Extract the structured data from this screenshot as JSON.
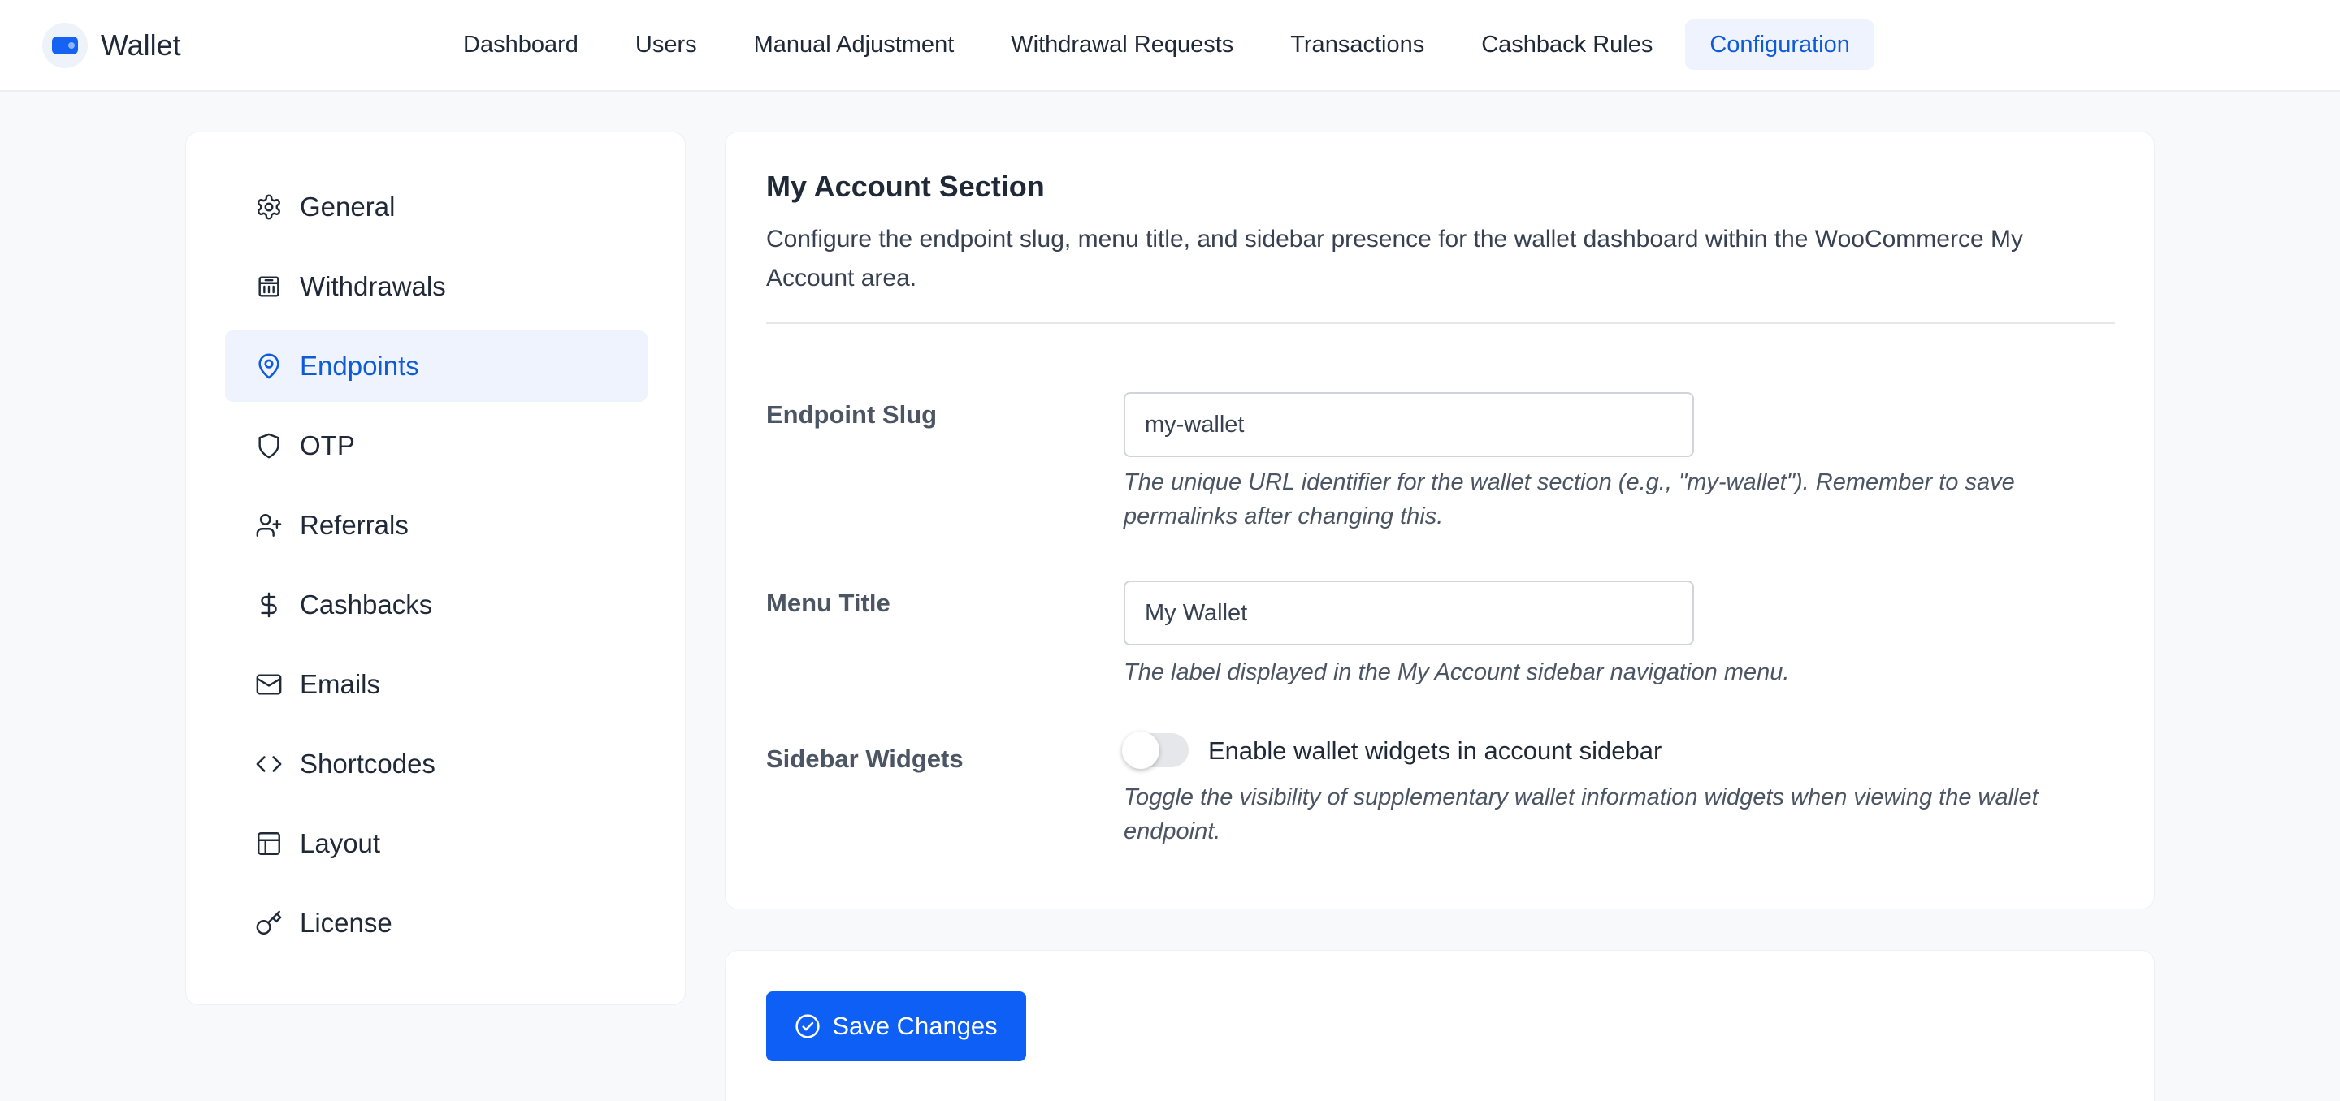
{
  "app": {
    "name": "Wallet"
  },
  "nav": {
    "items": [
      {
        "label": "Dashboard",
        "name": "nav-dashboard",
        "active": false
      },
      {
        "label": "Users",
        "name": "nav-users",
        "active": false
      },
      {
        "label": "Manual Adjustment",
        "name": "nav-manual-adjustment",
        "active": false
      },
      {
        "label": "Withdrawal Requests",
        "name": "nav-withdrawal-requests",
        "active": false
      },
      {
        "label": "Transactions",
        "name": "nav-transactions",
        "active": false
      },
      {
        "label": "Cashback Rules",
        "name": "nav-cashback-rules",
        "active": false
      },
      {
        "label": "Configuration",
        "name": "nav-configuration",
        "active": true
      }
    ]
  },
  "sidebar": {
    "items": [
      {
        "label": "General",
        "icon": "gear-icon",
        "active": false
      },
      {
        "label": "Withdrawals",
        "icon": "bank-icon",
        "active": false
      },
      {
        "label": "Endpoints",
        "icon": "map-pin-icon",
        "active": true
      },
      {
        "label": "OTP",
        "icon": "shield-icon",
        "active": false
      },
      {
        "label": "Referrals",
        "icon": "user-plus-icon",
        "active": false
      },
      {
        "label": "Cashbacks",
        "icon": "dollar-icon",
        "active": false
      },
      {
        "label": "Emails",
        "icon": "mail-icon",
        "active": false
      },
      {
        "label": "Shortcodes",
        "icon": "code-icon",
        "active": false
      },
      {
        "label": "Layout",
        "icon": "layout-icon",
        "active": false
      },
      {
        "label": "License",
        "icon": "key-icon",
        "active": false
      }
    ]
  },
  "section": {
    "title": "My Account Section",
    "description": "Configure the endpoint slug, menu title, and sidebar presence for the wallet dashboard within the WooCommerce My Account area."
  },
  "fields": {
    "endpoint_slug": {
      "label": "Endpoint Slug",
      "value": "my-wallet",
      "help": "The unique URL identifier for the wallet section (e.g., \"my-wallet\"). Remember to save permalinks after changing this."
    },
    "menu_title": {
      "label": "Menu Title",
      "value": "My Wallet",
      "help": "The label displayed in the My Account sidebar navigation menu."
    },
    "sidebar_widgets": {
      "label": "Sidebar Widgets",
      "toggle_label": "Enable wallet widgets in account sidebar",
      "enabled": false,
      "help": "Toggle the visibility of supplementary wallet information widgets when viewing the wallet endpoint."
    }
  },
  "actions": {
    "save_label": "Save Changes"
  },
  "colors": {
    "accent": "#0d5ff6",
    "active_text": "#0e5bd8",
    "active_bg": "#eef3fd"
  }
}
